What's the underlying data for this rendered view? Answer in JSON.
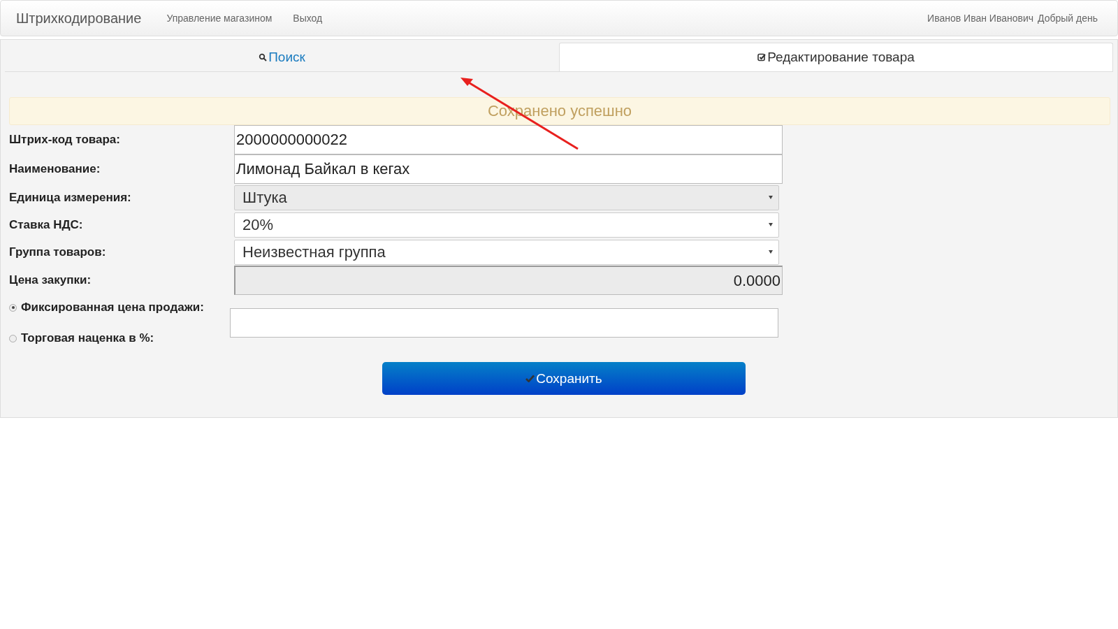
{
  "navbar": {
    "brand": "Штрихкодирование",
    "links": [
      "Управление магазином",
      "Выход"
    ],
    "user": "Иванов Иван Иванович",
    "greeting": "Добрый день"
  },
  "tabs": [
    {
      "label": "Поиск",
      "kind": "search",
      "selected": false
    },
    {
      "label": "Редактирование товара",
      "kind": "check",
      "selected": true
    }
  ],
  "alert": "Сохранено успешно",
  "fields": [
    {
      "label": "Штрих-код товара:",
      "kind": "input",
      "value": "2000000000022",
      "disabled": false
    },
    {
      "label": "Наименование:",
      "kind": "input",
      "value": "Лимонад Байкал в кегах",
      "disabled": false
    },
    {
      "label": "Единица измерения:",
      "kind": "select",
      "value": "Штука",
      "disabled": true
    },
    {
      "label": "Ставка НДС:",
      "kind": "select",
      "value": "20%",
      "disabled": false
    },
    {
      "label": "Группа товаров:",
      "kind": "select",
      "value": "Неизвестная группа",
      "disabled": false
    },
    {
      "label": "Цена закупки:",
      "kind": "input",
      "value": "0.0000",
      "disabled": true
    }
  ],
  "price_modes": [
    {
      "label": "Фиксированная цена продажи:",
      "selected": true
    },
    {
      "label": "Торговая наценка в %:",
      "selected": false
    }
  ],
  "save_button": "Сохранить"
}
